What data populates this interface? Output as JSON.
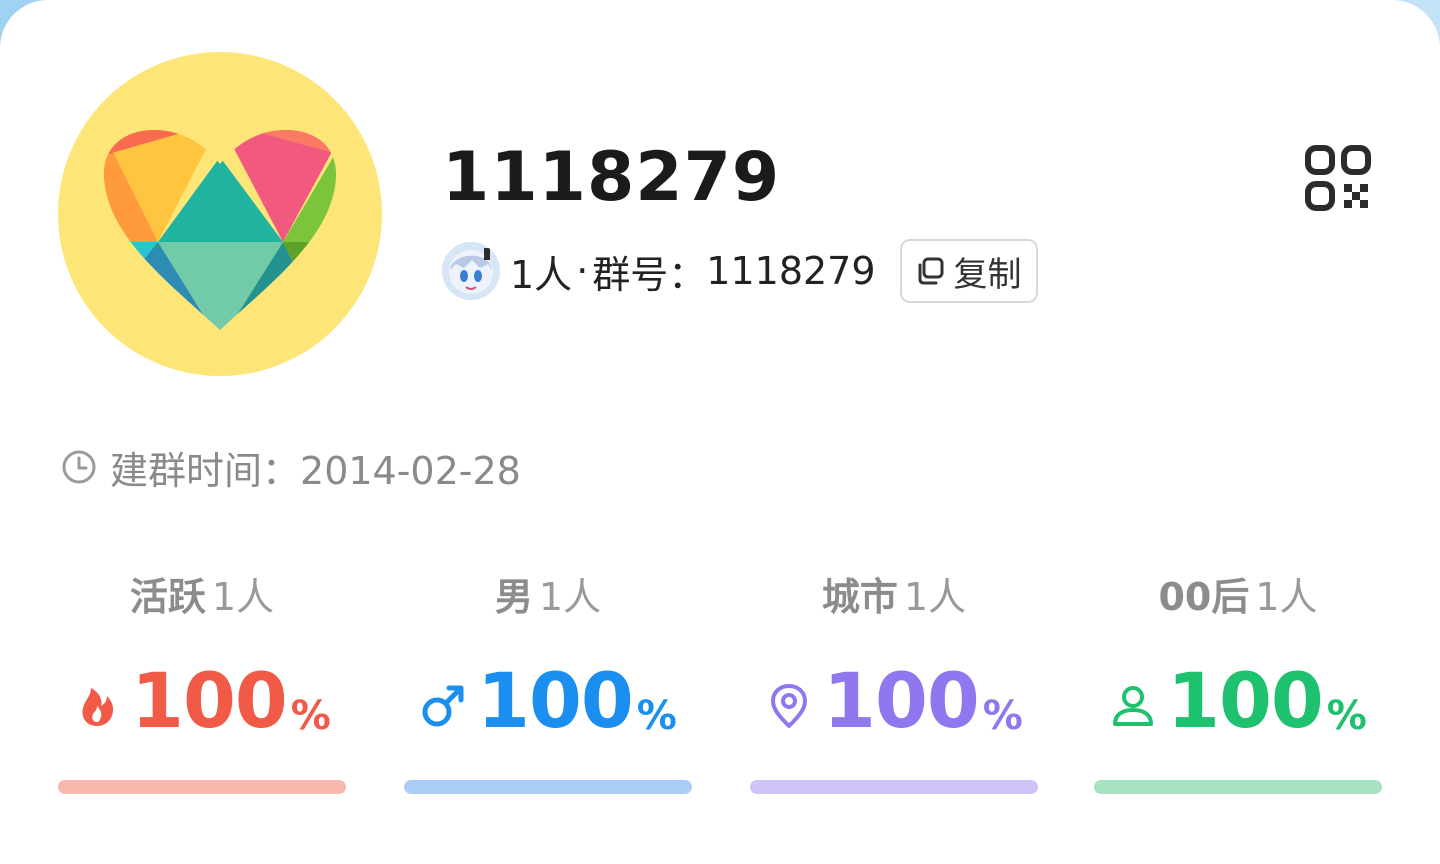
{
  "group": {
    "name": "1118279",
    "member_count_label": "1人",
    "separator": "·",
    "group_number_prefix": "群号：",
    "group_number": "1118279",
    "copy_label": "复制",
    "created_prefix": "建群时间：",
    "created_date": "2014-02-28"
  },
  "icons": {
    "avatar": "rainbow-heart-avatar",
    "qr": "qr-code-icon",
    "copy": "copy-icon",
    "clock": "clock-icon"
  },
  "stats": [
    {
      "key": "active",
      "title": "活跃",
      "count": "1人",
      "value": "100",
      "unit": "%",
      "icon": "flame-icon",
      "color": "#f05a46",
      "bar_color": "#f8b8ad",
      "fill": 1.0
    },
    {
      "key": "male",
      "title": "男",
      "count": "1人",
      "value": "100",
      "unit": "%",
      "icon": "male-icon",
      "color": "#1a8ff0",
      "bar_color": "#a9cdf6",
      "fill": 1.0
    },
    {
      "key": "city",
      "title": "城市",
      "count": "1人",
      "value": "100",
      "unit": "%",
      "icon": "location-pin-icon",
      "color": "#9077f0",
      "bar_color": "#cfc3f7",
      "fill": 1.0
    },
    {
      "key": "gen00",
      "title": "00后",
      "count": "1人",
      "value": "100",
      "unit": "%",
      "icon": "person-icon",
      "color": "#1ec26e",
      "bar_color": "#a7e2c1",
      "fill": 1.0
    }
  ]
}
